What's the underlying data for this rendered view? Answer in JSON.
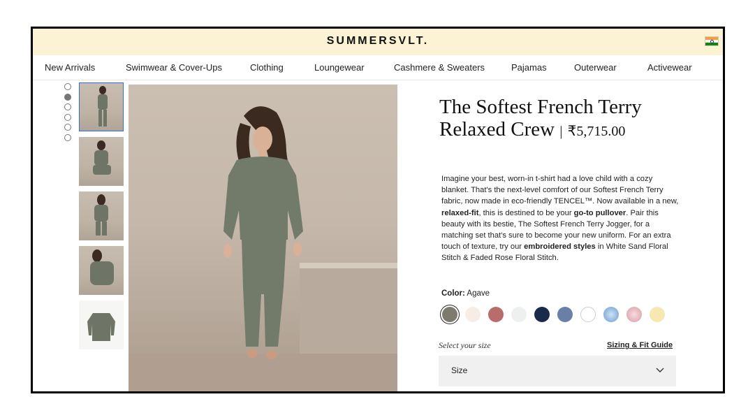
{
  "header": {
    "logo": "SUMMERSVLT.",
    "flag_icon": "india-flag-icon"
  },
  "nav": {
    "items": [
      "New Arrivals",
      "Swimwear & Cover-Ups",
      "Clothing",
      "Loungewear",
      "Cashmere & Sweaters",
      "Pajamas",
      "Outerwear",
      "Activewear"
    ]
  },
  "gallery": {
    "dot_count": 6,
    "active_dot": 1,
    "thumbnail_count": 5,
    "selected_thumbnail": 0
  },
  "product": {
    "title": "The Softest French Terry Relaxed Crew",
    "price_separator": "|",
    "price": "₹5,715.00",
    "description": {
      "p1": "Imagine your best, worn-in t-shirt had a love child with a cozy blanket. That's the next-level comfort of our Softest French Terry fabric, now made in eco-friendly TENCEL™. Now available in a new, ",
      "b1": "relaxed-fit",
      "p2": ", this is destined to be your ",
      "b2": "go-to pullover",
      "p3": ". Pair this beauty with its bestie, The Softest French Terry Jogger, for a matching set that's sure to become your new uniform. For an extra touch of texture, try our ",
      "b3": "embroidered styles",
      "p4": " in White Sand Floral Stitch & Faded Rose Floral Stitch."
    },
    "color_label": "Color:",
    "color_value": "Agave",
    "swatches": [
      {
        "name": "agave",
        "color": "#7d7a6e"
      },
      {
        "name": "white-floral",
        "color": "#f6eee6"
      },
      {
        "name": "faded-rose-red",
        "color": "#b86c6c"
      },
      {
        "name": "white-speckle",
        "color": "#eef0f0"
      },
      {
        "name": "navy-star",
        "color": "#1a2a4a"
      },
      {
        "name": "slate-blue",
        "color": "#6a7fa8"
      },
      {
        "name": "white",
        "color": "#ffffff"
      },
      {
        "name": "blue-tie-dye",
        "color": "#7aa8d6"
      },
      {
        "name": "pink-tie-dye",
        "color": "#e7b6bd"
      },
      {
        "name": "pale-yellow",
        "color": "#f7e7b0"
      }
    ],
    "selected_swatch": 0,
    "size_prompt": "Select your size",
    "size_guide": "Sizing & Fit Guide",
    "size_select": "Size"
  },
  "colors": {
    "header_bg": "#fbf3d3",
    "thumb_border": "#2f6fd6"
  }
}
